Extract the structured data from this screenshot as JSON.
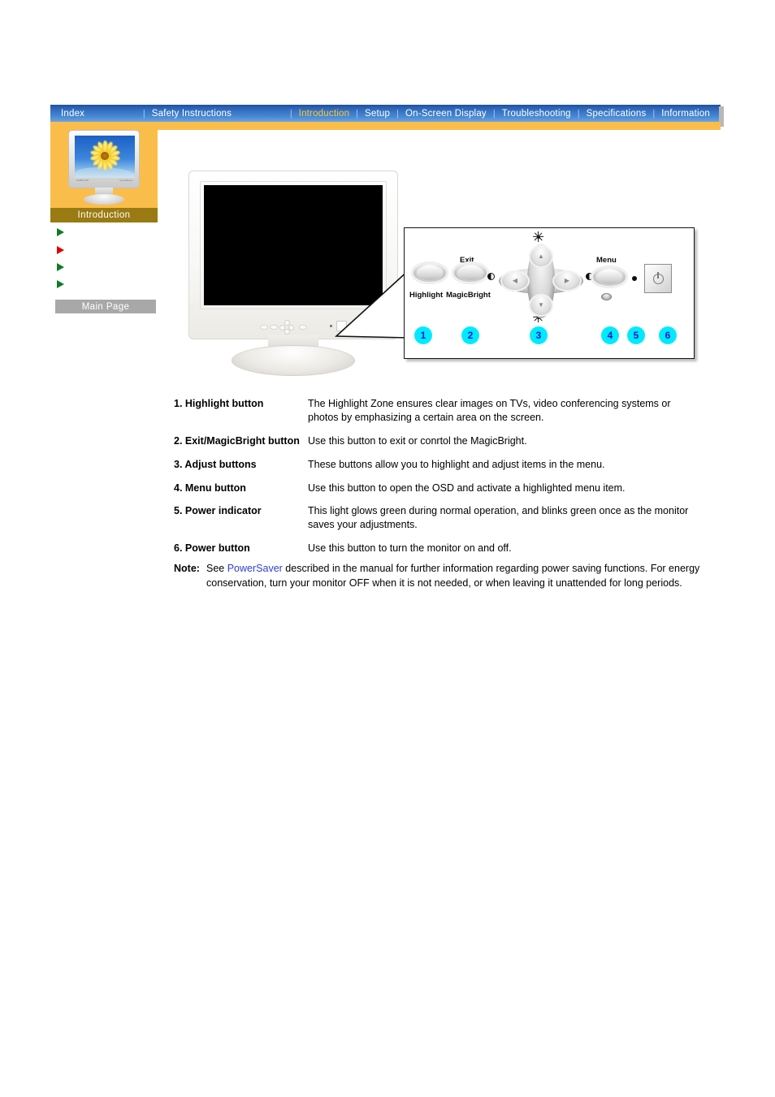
{
  "nav": {
    "items": [
      {
        "label": "Index",
        "active": false
      },
      {
        "label": "Safety Instructions",
        "active": false
      },
      {
        "label": "Introduction",
        "active": true
      },
      {
        "label": "Setup",
        "active": false
      },
      {
        "label": "On-Screen Display",
        "active": false
      },
      {
        "label": "Troubleshooting",
        "active": false
      },
      {
        "label": "Specifications",
        "active": false
      },
      {
        "label": "Information",
        "active": false
      }
    ],
    "separator": "|"
  },
  "sidebar": {
    "title": "Introduction",
    "thumbnail_brand_left": "SAMSUNG",
    "thumbnail_brand_right": "SyncMaster",
    "bullets": [
      {
        "color": "#0f7a27"
      },
      {
        "color": "#e00000"
      },
      {
        "color": "#0f7a27"
      },
      {
        "color": "#0f7a27"
      }
    ],
    "main_page_label": "Main Page"
  },
  "control_panel": {
    "labels": {
      "highlight": "Highlight",
      "exit": "Exit",
      "magicbright": "MagicBright",
      "menu": "Menu"
    },
    "badges": [
      "1",
      "2",
      "3",
      "4",
      "5",
      "6"
    ],
    "badge_bg": "#00eaff",
    "badge_fg": "#1414d2"
  },
  "descriptions": [
    {
      "term": "1. Highlight button",
      "definition": "The Highlight Zone ensures clear images on TVs, video conferencing systems or photos by emphasizing a certain area on the screen."
    },
    {
      "term": "2. Exit/MagicBright button",
      "definition": "Use this button to exit or conrtol the MagicBright."
    },
    {
      "term": "3. Adjust buttons",
      "definition": "These buttons allow you to highlight and adjust items in the menu."
    },
    {
      "term": "4. Menu button",
      "definition": "Use this button to open the OSD and activate a highlighted menu item."
    },
    {
      "term": "5. Power indicator",
      "definition": "This light glows green during normal operation, and blinks green once as the monitor saves your adjustments."
    },
    {
      "term": "6. Power button",
      "definition": "Use this button to turn the monitor on and off."
    }
  ],
  "note": {
    "label": "Note:",
    "text_before_link": "See ",
    "link": "PowerSaver",
    "text_after_link": " described in the manual for further information regarding power saving functions. For energy conservation, turn your monitor OFF when it is not needed, or when leaving it unattended for long periods."
  },
  "colors": {
    "nav_bg": "#2c63b4",
    "nav_active": "#ffc92e",
    "orange": "#fbbd4a",
    "sidebar_title_bg": "#9a7a12",
    "main_page_bg": "#a8a8a8",
    "link": "#2b3fd0"
  }
}
